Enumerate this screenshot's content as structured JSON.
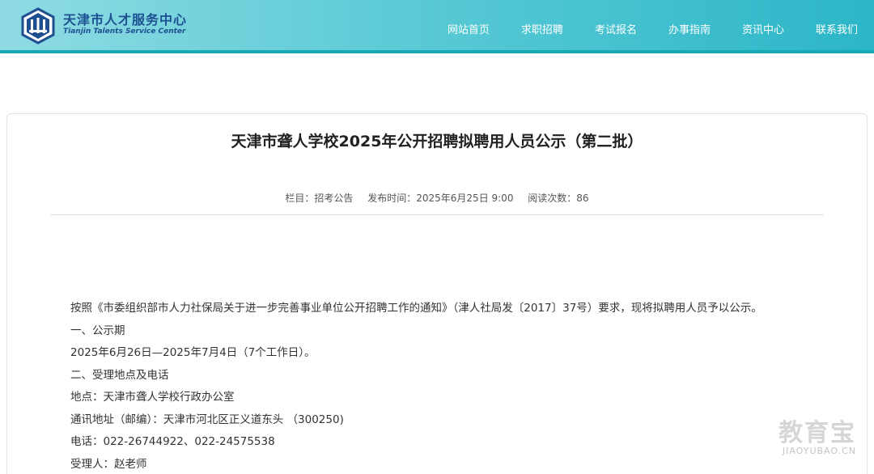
{
  "header": {
    "brand_cn": "天津市人才服务中心",
    "brand_en": "Tianjin Talents Service Center",
    "nav": [
      "网站首页",
      "求职招聘",
      "考试报名",
      "办事指南",
      "资讯中心",
      "联系我们"
    ]
  },
  "article": {
    "title": "天津市聋人学校2025年公开招聘拟聘用人员公示（第二批）",
    "meta": {
      "column": "栏目：招考公告",
      "published": "发布时间：2025年6月25日 9:00",
      "views": "阅读次数：86"
    },
    "paragraphs": [
      "按照《市委组织部市人力社保局关于进一步完善事业单位公开招聘工作的通知》（津人社局发〔2017〕37号）要求，现将拟聘用人员予以公示。",
      "一、公示期",
      "2025年6月26日—2025年7月4日（7个工作日）。",
      "二、受理地点及电话",
      "地点：天津市聋人学校行政办公室",
      "通讯地址（邮编）：天津市河北区正义道东头 （300250)",
      "电话：022-26744922、022-24575538",
      "受理人：赵老师"
    ]
  },
  "watermark": {
    "cn": "教育宝",
    "en": "JIAOYUBAO.CN"
  },
  "colors": {
    "header_start": "#8fdbe3",
    "header_end": "#2cb6c8",
    "brand": "#1d4f91"
  }
}
